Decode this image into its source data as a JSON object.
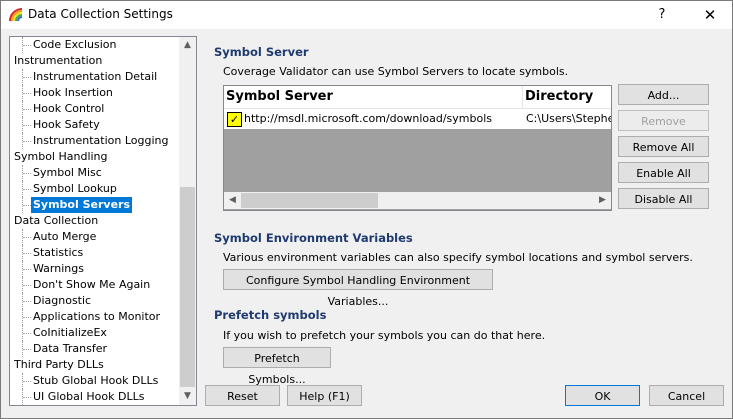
{
  "window": {
    "title": "Data Collection Settings",
    "help_glyph": "?",
    "close_glyph": "✕"
  },
  "tree": {
    "items": [
      {
        "label": "Code Exclusion",
        "kind": "leaf"
      },
      {
        "label": "Instrumentation",
        "kind": "cat"
      },
      {
        "label": "Instrumentation Detail",
        "kind": "leaf"
      },
      {
        "label": "Hook Insertion",
        "kind": "leaf"
      },
      {
        "label": "Hook Control",
        "kind": "leaf"
      },
      {
        "label": "Hook Safety",
        "kind": "leaf"
      },
      {
        "label": "Instrumentation Logging",
        "kind": "leaf"
      },
      {
        "label": "Symbol Handling",
        "kind": "cat"
      },
      {
        "label": "Symbol Misc",
        "kind": "leaf"
      },
      {
        "label": "Symbol Lookup",
        "kind": "leaf"
      },
      {
        "label": "Symbol Servers",
        "kind": "leaf",
        "selected": true
      },
      {
        "label": "Data Collection",
        "kind": "cat"
      },
      {
        "label": "Auto Merge",
        "kind": "leaf"
      },
      {
        "label": "Statistics",
        "kind": "leaf"
      },
      {
        "label": "Warnings",
        "kind": "leaf"
      },
      {
        "label": "Don't Show Me Again",
        "kind": "leaf"
      },
      {
        "label": "Diagnostic",
        "kind": "leaf"
      },
      {
        "label": "Applications to Monitor",
        "kind": "leaf"
      },
      {
        "label": "CoInitializeEx",
        "kind": "leaf"
      },
      {
        "label": "Data Transfer",
        "kind": "leaf"
      },
      {
        "label": "Third Party DLLs",
        "kind": "cat"
      },
      {
        "label": "Stub Global Hook DLLs",
        "kind": "leaf"
      },
      {
        "label": "UI Global Hook DLLs",
        "kind": "leaf"
      }
    ]
  },
  "symbol_server": {
    "title": "Symbol Server",
    "description": "Coverage Validator can use Symbol Servers to locate symbols.",
    "columns": [
      "Symbol Server",
      "Directory"
    ],
    "rows": [
      {
        "checked": true,
        "server": "http://msdl.microsoft.com/download/symbols",
        "directory": "C:\\Users\\Stephe"
      }
    ],
    "buttons": {
      "add": "Add...",
      "remove": "Remove",
      "remove_all": "Remove All",
      "enable_all": "Enable All",
      "disable_all": "Disable All"
    }
  },
  "env": {
    "title": "Symbol Environment Variables",
    "description": "Various environment variables can also specify symbol locations and symbol servers.",
    "button": "Configure Symbol Handling Environment Variables..."
  },
  "prefetch": {
    "title": "Prefetch symbols",
    "description": "If you wish to prefetch your symbols you can do that here.",
    "button": "Prefetch Symbols..."
  },
  "footer": {
    "reset": "Reset",
    "help": "Help (F1)",
    "ok": "OK",
    "cancel": "Cancel"
  }
}
